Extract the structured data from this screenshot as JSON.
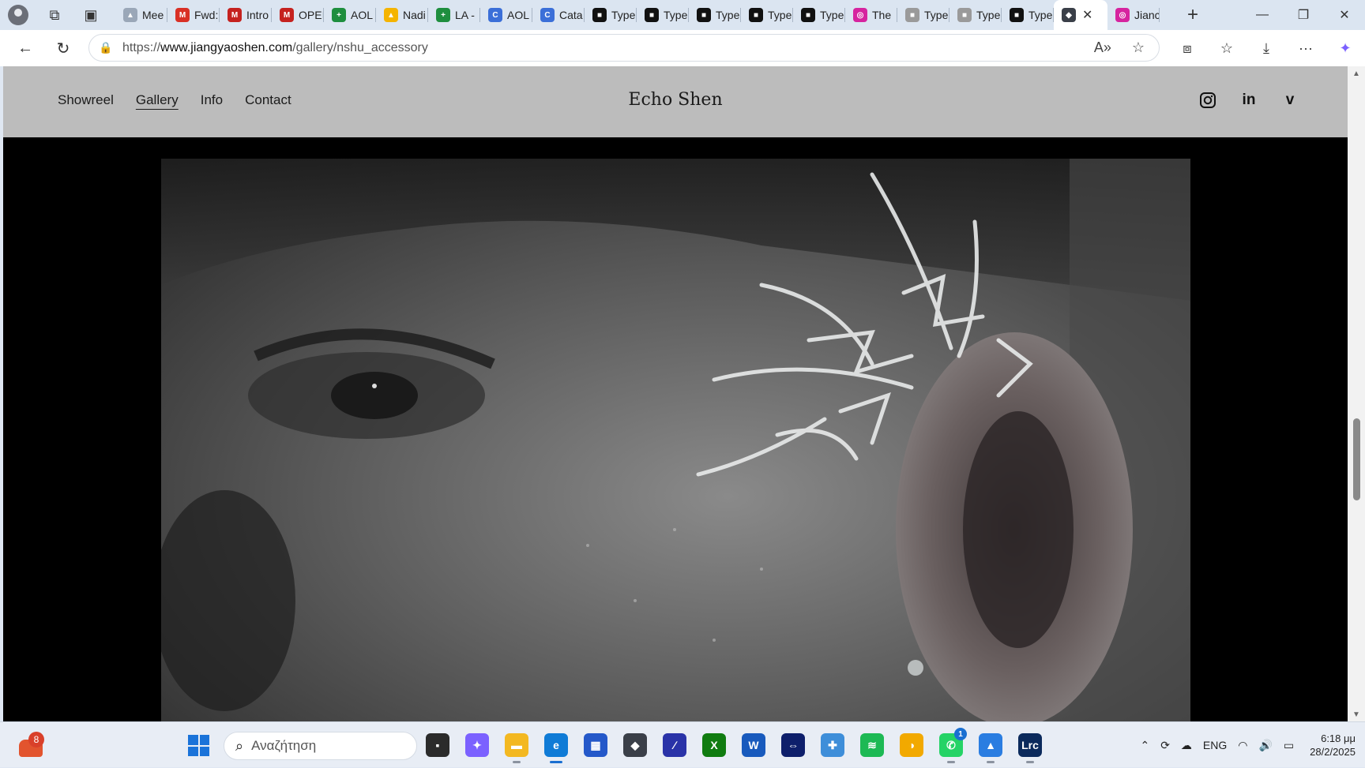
{
  "browser": {
    "tabs": [
      {
        "title": "Mee",
        "fav_color": "#9aa7b8",
        "fav_glyph": "▲"
      },
      {
        "title": "Fwd:",
        "fav_color": "#d93025",
        "fav_glyph": "M"
      },
      {
        "title": "Intro",
        "fav_color": "#c5221f",
        "fav_glyph": "M"
      },
      {
        "title": "OPEI",
        "fav_color": "#c5221f",
        "fav_glyph": "M"
      },
      {
        "title": "AOL",
        "fav_color": "#1e8e3e",
        "fav_glyph": "+"
      },
      {
        "title": "Nadi",
        "fav_color": "#f5b400",
        "fav_glyph": "▲"
      },
      {
        "title": "LA -",
        "fav_color": "#1e8e3e",
        "fav_glyph": "+"
      },
      {
        "title": "AOL",
        "fav_color": "#3b6fd8",
        "fav_glyph": "C"
      },
      {
        "title": "Cata",
        "fav_color": "#3b6fd8",
        "fav_glyph": "C"
      },
      {
        "title": "Type",
        "fav_color": "#111111",
        "fav_glyph": "■"
      },
      {
        "title": "Type",
        "fav_color": "#111111",
        "fav_glyph": "■"
      },
      {
        "title": "Type",
        "fav_color": "#111111",
        "fav_glyph": "■"
      },
      {
        "title": "Type",
        "fav_color": "#111111",
        "fav_glyph": "■"
      },
      {
        "title": "Type",
        "fav_color": "#111111",
        "fav_glyph": "■"
      },
      {
        "title": "The",
        "fav_color": "#d6249f",
        "fav_glyph": "◎"
      },
      {
        "title": "Type",
        "fav_color": "#9a9a9a",
        "fav_glyph": "■"
      },
      {
        "title": "Type",
        "fav_color": "#9a9a9a",
        "fav_glyph": "■"
      },
      {
        "title": "Type",
        "fav_color": "#111111",
        "fav_glyph": "■"
      },
      {
        "title": "",
        "fav_color": "#3a3f48",
        "fav_glyph": "◆",
        "active": true
      },
      {
        "title": "Jianc",
        "fav_color": "#d6249f",
        "fav_glyph": "◎"
      }
    ],
    "url_prefix": "https://",
    "url_domain": "www.jiangyaoshen.com",
    "url_path": "/gallery/nshu_accessory"
  },
  "site": {
    "nav": [
      "Showreel",
      "Gallery",
      "Info",
      "Contact"
    ],
    "active_nav": "Gallery",
    "title": "Echo Shen",
    "social": [
      "instagram",
      "linkedin",
      "vimeo"
    ]
  },
  "taskbar": {
    "widget_badge": "8",
    "search_placeholder": "Αναζήτηση",
    "apps": [
      {
        "name": "file-explorer-dark",
        "color": "#2b2b2b",
        "glyph": "▪"
      },
      {
        "name": "copilot",
        "color": "#7b61ff",
        "glyph": "✦"
      },
      {
        "name": "file-explorer",
        "color": "#f3b821",
        "glyph": "▬",
        "running": true
      },
      {
        "name": "edge",
        "color": "#0f7bd6",
        "glyph": "e",
        "running": true,
        "active": true
      },
      {
        "name": "store",
        "color": "#2458c9",
        "glyph": "▦"
      },
      {
        "name": "app-cube",
        "color": "#3a3f48",
        "glyph": "◆"
      },
      {
        "name": "affinity",
        "color": "#2a33a8",
        "glyph": "∕"
      },
      {
        "name": "xbox",
        "color": "#107c10",
        "glyph": "X"
      },
      {
        "name": "word",
        "color": "#185abd",
        "glyph": "W"
      },
      {
        "name": "teamviewer",
        "color": "#0e1f6b",
        "glyph": "⇔"
      },
      {
        "name": "maps",
        "color": "#3e8ed9",
        "glyph": "✚"
      },
      {
        "name": "spotify",
        "color": "#1db954",
        "glyph": "≋"
      },
      {
        "name": "norton",
        "color": "#f2a900",
        "glyph": "◑"
      },
      {
        "name": "whatsapp",
        "color": "#25d366",
        "glyph": "✆",
        "badge": "1",
        "running": true
      },
      {
        "name": "photos",
        "color": "#2a7de1",
        "glyph": "▲",
        "running": true
      },
      {
        "name": "lightroom",
        "color": "#0b2a5c",
        "glyph": "Lrc",
        "running": true
      }
    ],
    "lang": "ENG",
    "time": "6:18 μμ",
    "date": "28/2/2025"
  }
}
